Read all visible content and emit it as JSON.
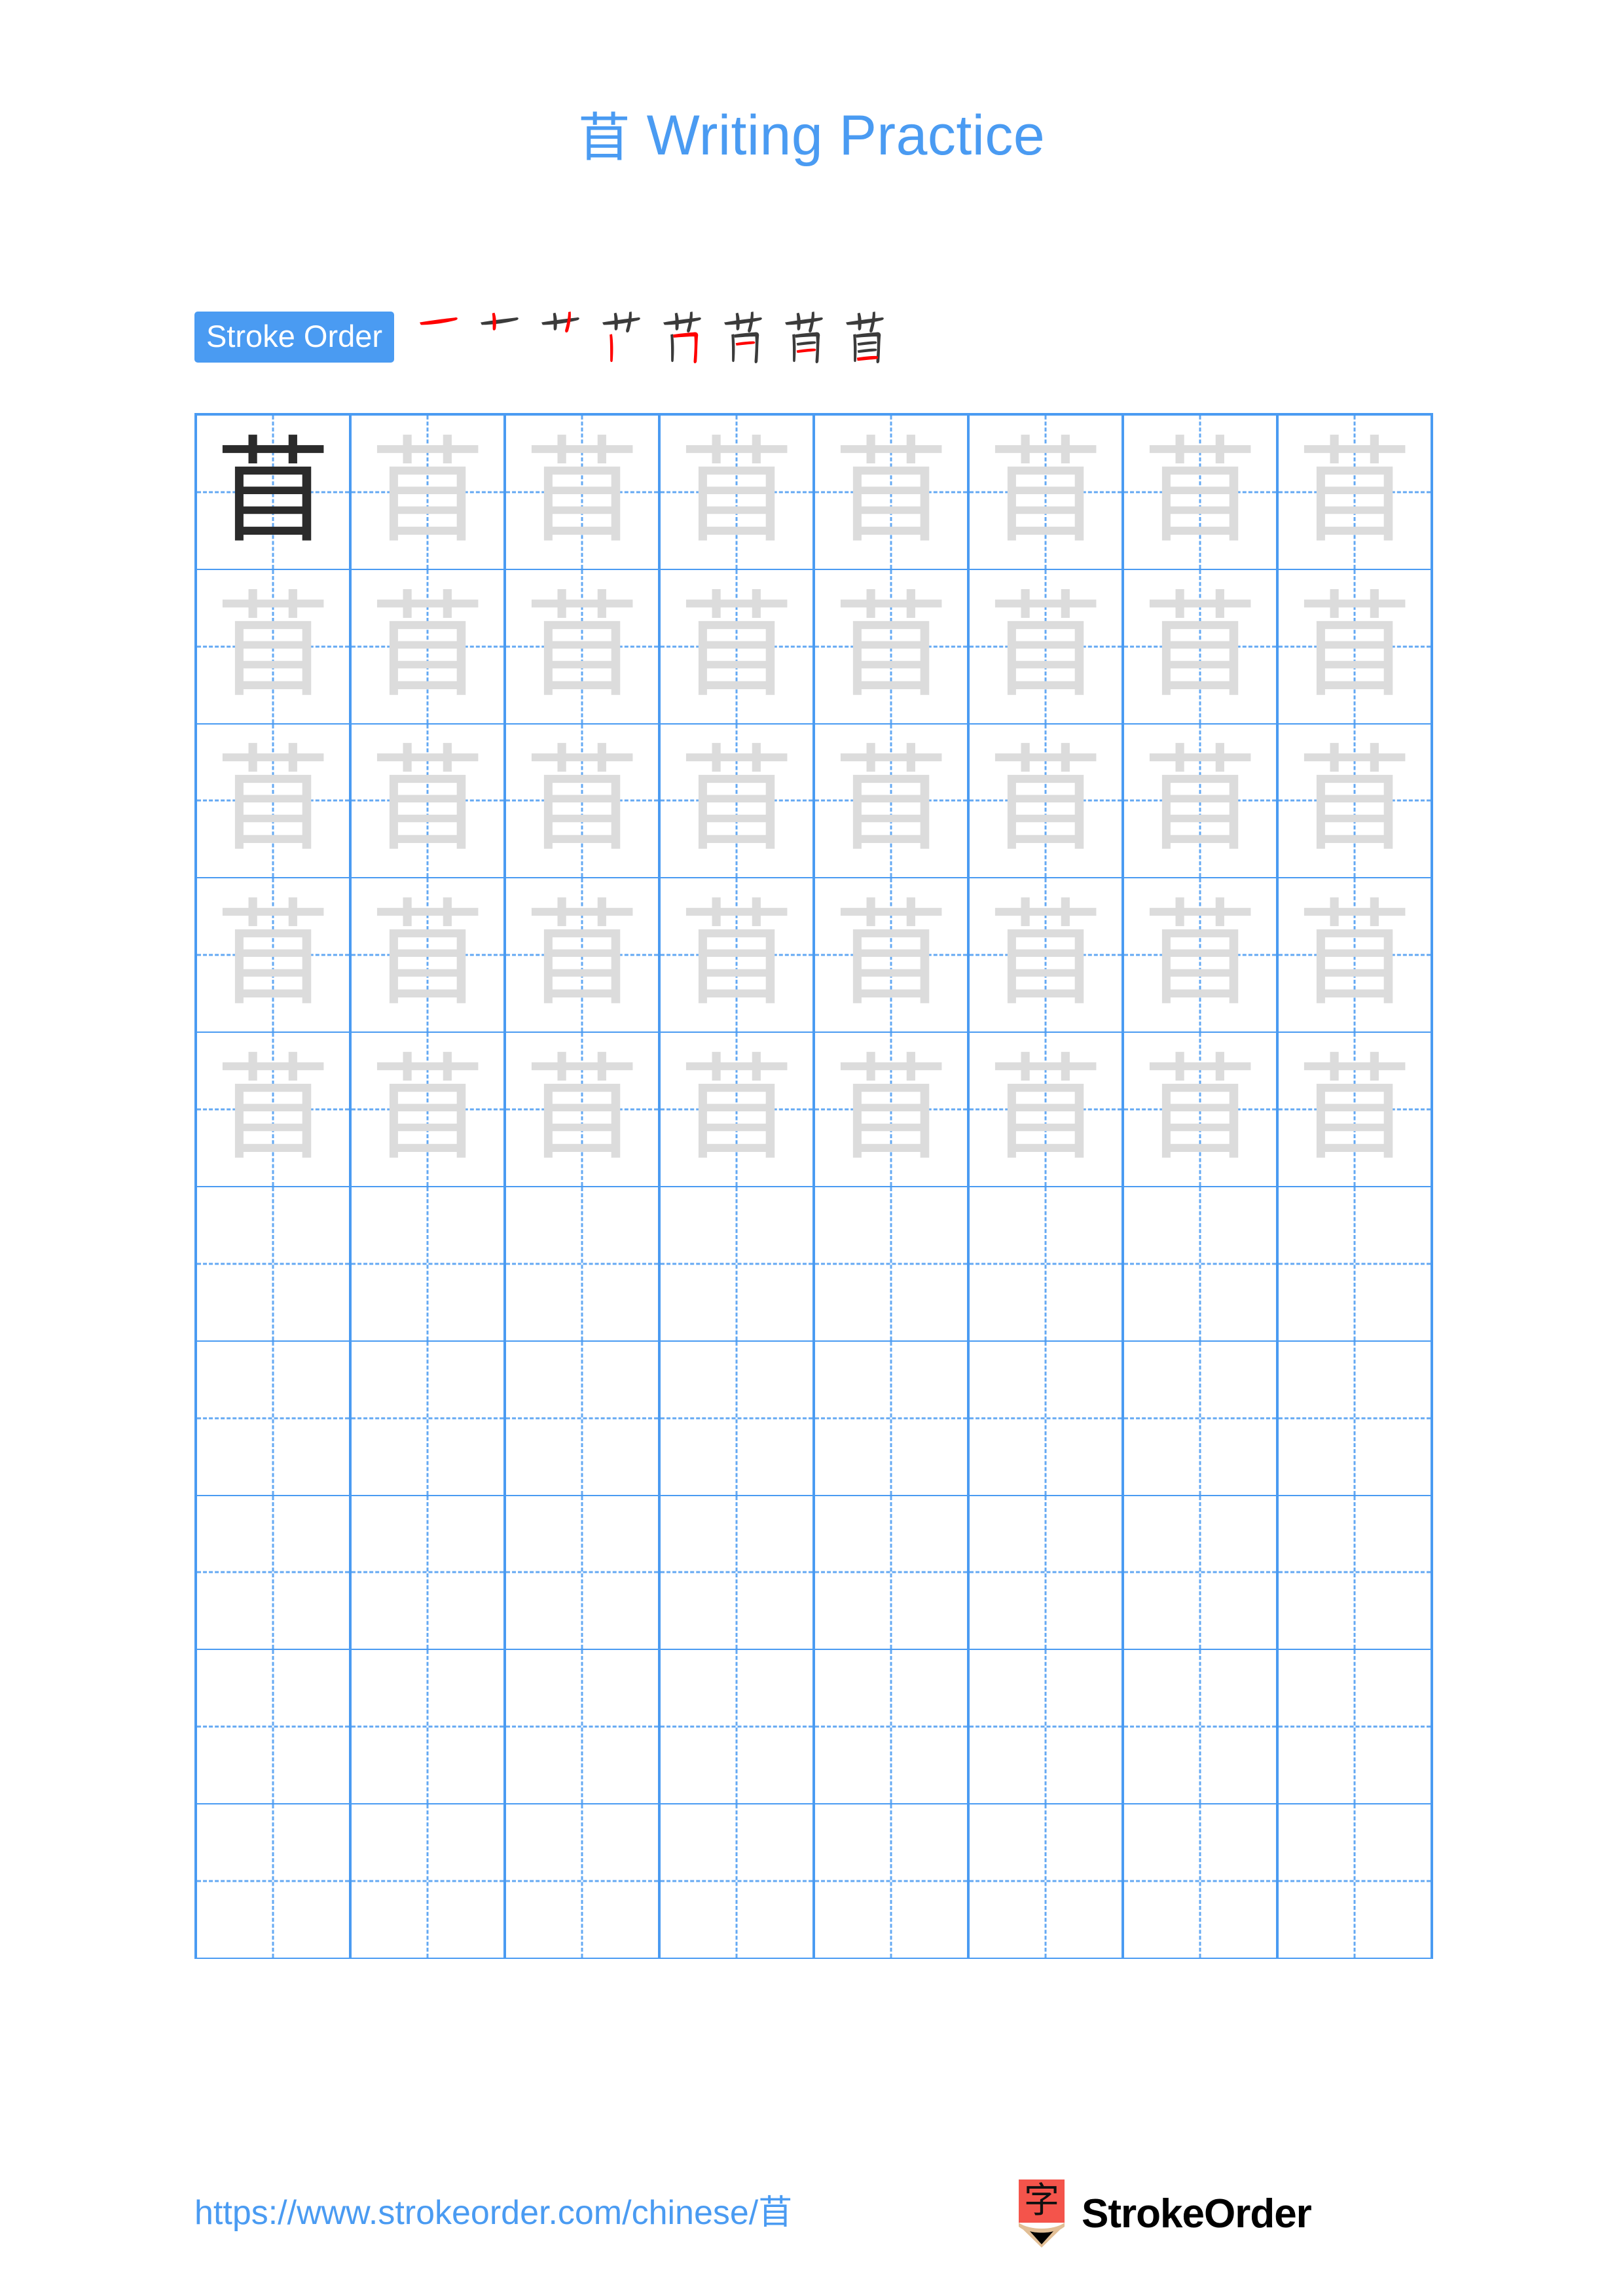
{
  "page": {
    "character": "苜",
    "title_suffix": " Writing Practice",
    "background": "#ffffff",
    "accent_color": "#4a9bf2",
    "trace_color": "#dcdcdc",
    "ink_color": "#2b2b2b",
    "highlight_stroke_color": "#ff0000"
  },
  "stroke_order": {
    "label": "Stroke Order",
    "stroke_count": 8,
    "steps": [
      {
        "index": 1,
        "new_stroke": "héng (horizontal)",
        "glyph": "一"
      },
      {
        "index": 2,
        "new_stroke": "shù (vertical)",
        "glyph": "十"
      },
      {
        "index": 3,
        "new_stroke": "shù (vertical)",
        "glyph": "艹"
      },
      {
        "index": 4,
        "new_stroke": "shù (vertical left)",
        "glyph": "艹丨"
      },
      {
        "index": 5,
        "new_stroke": "héngzhé (horizontal-turn)",
        "glyph": "艹冂"
      },
      {
        "index": 6,
        "new_stroke": "héng (horizontal inner)",
        "glyph": "苩"
      },
      {
        "index": 7,
        "new_stroke": "héng (horizontal inner)",
        "glyph": "苜"
      },
      {
        "index": 8,
        "new_stroke": "héng (horizontal bottom)",
        "glyph": "苜"
      }
    ]
  },
  "grid": {
    "columns": 8,
    "rows": 10,
    "cells": [
      [
        "dark",
        "trace",
        "trace",
        "trace",
        "trace",
        "trace",
        "trace",
        "trace"
      ],
      [
        "trace",
        "trace",
        "trace",
        "trace",
        "trace",
        "trace",
        "trace",
        "trace"
      ],
      [
        "trace",
        "trace",
        "trace",
        "trace",
        "trace",
        "trace",
        "trace",
        "trace"
      ],
      [
        "trace",
        "trace",
        "trace",
        "trace",
        "trace",
        "trace",
        "trace",
        "trace"
      ],
      [
        "trace",
        "trace",
        "trace",
        "trace",
        "trace",
        "trace",
        "trace",
        "trace"
      ],
      [
        "blank",
        "blank",
        "blank",
        "blank",
        "blank",
        "blank",
        "blank",
        "blank"
      ],
      [
        "blank",
        "blank",
        "blank",
        "blank",
        "blank",
        "blank",
        "blank",
        "blank"
      ],
      [
        "blank",
        "blank",
        "blank",
        "blank",
        "blank",
        "blank",
        "blank",
        "blank"
      ],
      [
        "blank",
        "blank",
        "blank",
        "blank",
        "blank",
        "blank",
        "blank",
        "blank"
      ],
      [
        "blank",
        "blank",
        "blank",
        "blank",
        "blank",
        "blank",
        "blank",
        "blank"
      ]
    ]
  },
  "footer": {
    "url": "https://www.strokeorder.com/chinese/苜",
    "brand_name": "StrokeOrder",
    "logo_char": "字",
    "logo_body_color": "#f4544b",
    "logo_wood_color": "#e2bf96",
    "logo_tip_color": "#000000"
  }
}
